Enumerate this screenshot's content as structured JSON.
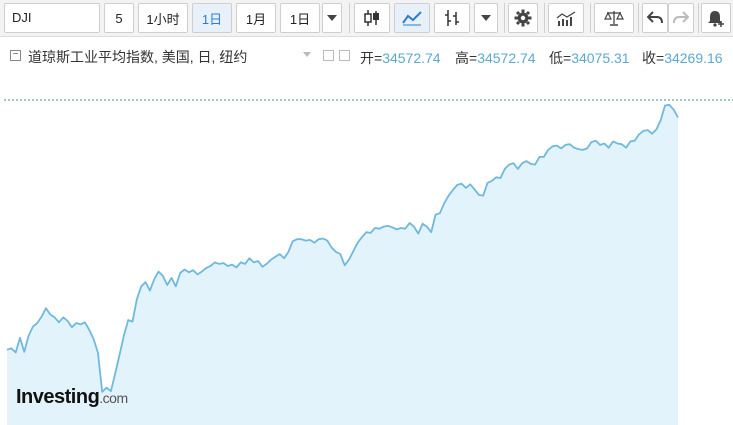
{
  "toolbar": {
    "symbol": "DJI",
    "count": "5",
    "intervals": [
      "1小时",
      "1日",
      "1月",
      "1日"
    ],
    "active_interval_index": 1,
    "icons": [
      "candlestick-icon",
      "line-chart-icon",
      "bar-chart-icon",
      "dropdown-icon",
      "gear-icon",
      "indicators-icon",
      "compare-icon",
      "undo-icon",
      "redo-icon",
      "alert-icon"
    ]
  },
  "legend": {
    "title": "道琼斯工业平均指数, 美国, 日, 纽约",
    "open_label": "开=",
    "open": "34572.74",
    "high_label": "高=",
    "high": "34572.74",
    "low_label": "低=",
    "low": "34075.31",
    "close_label": "收=",
    "close": "34269.16"
  },
  "logo": {
    "brand": "Investing",
    "domain": ".com"
  },
  "colors": {
    "line": "#6fb9dc",
    "fill": "#e3f3fb",
    "accent": "#5aa9cf",
    "ref_line": "#3f8f8f"
  },
  "chart_data": {
    "type": "area",
    "title": "道琼斯工业平均指数, 美国, 日, 纽约",
    "xlabel": "",
    "ylabel": "",
    "grid": false,
    "ylim": [
      29650,
      35050
    ],
    "reference_value": 34269.16,
    "series": [
      {
        "values": [
          30720,
          30740,
          30680,
          30890,
          30690,
          30920,
          31050,
          31100,
          31190,
          31310,
          31220,
          31180,
          31110,
          31180,
          31130,
          31040,
          31100,
          31080,
          31110,
          31000,
          30870,
          30680,
          30120,
          30180,
          30130,
          30380,
          30650,
          30920,
          31140,
          31120,
          31440,
          31620,
          31680,
          31560,
          31720,
          31830,
          31770,
          31640,
          31740,
          31620,
          31810,
          31860,
          31820,
          31850,
          31790,
          31830,
          31880,
          31910,
          31960,
          31940,
          31950,
          31910,
          31930,
          31890,
          31960,
          31940,
          32020,
          31960,
          31980,
          31900,
          31940,
          32000,
          32040,
          32080,
          32020,
          32110,
          32260,
          32290,
          32290,
          32270,
          32280,
          32240,
          32290,
          32300,
          32270,
          32170,
          32110,
          32080,
          31920,
          32000,
          32120,
          32240,
          32320,
          32390,
          32380,
          32450,
          32440,
          32470,
          32480,
          32460,
          32430,
          32450,
          32440,
          32520,
          32470,
          32370,
          32510,
          32470,
          32390,
          32640,
          32660,
          32800,
          32910,
          32990,
          33060,
          33080,
          33020,
          33070,
          33000,
          32920,
          32910,
          33090,
          33120,
          33170,
          33160,
          33290,
          33350,
          33370,
          33290,
          33370,
          33400,
          33360,
          33350,
          33460,
          33460,
          33560,
          33610,
          33620,
          33580,
          33630,
          33640,
          33590,
          33570,
          33560,
          33580,
          33670,
          33690,
          33630,
          33650,
          33590,
          33680,
          33650,
          33640,
          33590,
          33680,
          33690,
          33780,
          33830,
          33840,
          33790,
          33850,
          33980,
          34190,
          34200,
          34130,
          34020
        ]
      }
    ]
  }
}
